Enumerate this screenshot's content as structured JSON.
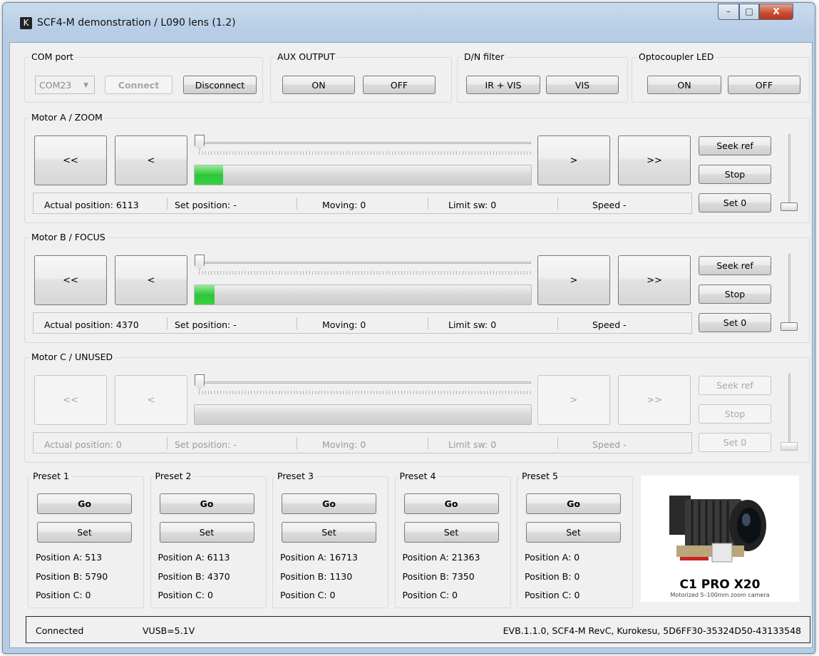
{
  "window": {
    "title": "SCF4-M demonstration / L090 lens (1.2)",
    "app_icon": "K",
    "controls": {
      "minimize": "–",
      "maximize": "□",
      "close": "X"
    }
  },
  "com": {
    "title": "COM port",
    "port": "COM23",
    "connect": "Connect",
    "disconnect": "Disconnect"
  },
  "aux": {
    "title": "AUX OUTPUT",
    "on": "ON",
    "off": "OFF"
  },
  "dn": {
    "title": "D/N filter",
    "irvis": "IR + VIS",
    "vis": "VIS"
  },
  "opto": {
    "title": "Optocoupler LED",
    "on": "ON",
    "off": "OFF"
  },
  "motors": [
    {
      "title": "Motor A / ZOOM",
      "enabled": true,
      "progress": 0.085,
      "buttons": {
        "ff_back": "<<",
        "back": "<",
        "fwd": ">",
        "ff_fwd": ">>",
        "seek": "Seek ref",
        "stop": "Stop",
        "set0": "Set 0"
      },
      "status": {
        "actual": "Actual position:  6113",
        "set": "Set position:  -",
        "moving": "Moving:  0",
        "limit": "Limit sw:  0",
        "speed": "Speed  -"
      }
    },
    {
      "title": "Motor B / FOCUS",
      "enabled": true,
      "progress": 0.06,
      "buttons": {
        "ff_back": "<<",
        "back": "<",
        "fwd": ">",
        "ff_fwd": ">>",
        "seek": "Seek ref",
        "stop": "Stop",
        "set0": "Set 0"
      },
      "status": {
        "actual": "Actual position:  4370",
        "set": "Set position:  -",
        "moving": "Moving:  0",
        "limit": "Limit sw:  0",
        "speed": "Speed  -"
      }
    },
    {
      "title": "Motor C / UNUSED",
      "enabled": false,
      "progress": 0,
      "buttons": {
        "ff_back": "<<",
        "back": "<",
        "fwd": ">",
        "ff_fwd": ">>",
        "seek": "Seek ref",
        "stop": "Stop",
        "set0": "Set 0"
      },
      "status": {
        "actual": "Actual position:  0",
        "set": "Set position:  -",
        "moving": "Moving:  0",
        "limit": "Limit sw:  0",
        "speed": "Speed  -"
      }
    }
  ],
  "presets": [
    {
      "title": "Preset 1",
      "go": "Go",
      "set": "Set",
      "a": "Position A:  513",
      "b": "Position B:  5790",
      "c": "Position C:  0"
    },
    {
      "title": "Preset 2",
      "go": "Go",
      "set": "Set",
      "a": "Position A:  6113",
      "b": "Position B:  4370",
      "c": "Position C:  0"
    },
    {
      "title": "Preset 3",
      "go": "Go",
      "set": "Set",
      "a": "Position A:  16713",
      "b": "Position B:  1130",
      "c": "Position C:  0"
    },
    {
      "title": "Preset 4",
      "go": "Go",
      "set": "Set",
      "a": "Position A:  21363",
      "b": "Position B:  7350",
      "c": "Position C:  0"
    },
    {
      "title": "Preset 5",
      "go": "Go",
      "set": "Set",
      "a": "Position A:  0",
      "b": "Position B:  0",
      "c": "Position C:  0"
    }
  ],
  "promo": {
    "name": "C1 PRO X20",
    "tagline": "Motorized 5–100mm zoom camera"
  },
  "statusbar": {
    "connection": "Connected",
    "vusb": "VUSB=5.1V",
    "device": "EVB.1.1.0, SCF4-M RevC, Kurokesu, 5D6FF30-35324D50-43133548"
  }
}
